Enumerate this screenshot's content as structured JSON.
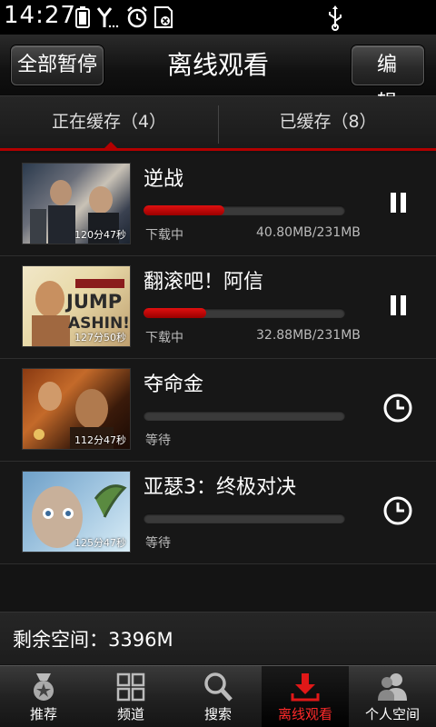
{
  "statusbar": {
    "time": "14:27"
  },
  "titlebar": {
    "left_button": "全部暂停",
    "title": "离线观看",
    "right_button": "编 辑"
  },
  "tabs": [
    {
      "label": "正在缓存（4）",
      "active": true
    },
    {
      "label": "已缓存（8）",
      "active": false
    }
  ],
  "downloads": [
    {
      "title": "逆战",
      "duration": "120分47秒",
      "progress": 0.4,
      "status": "下载中",
      "size": "40.80MB/231MB",
      "action": "pause-icon"
    },
    {
      "title": "翻滚吧！阿信",
      "duration": "127分50秒",
      "progress": 0.31,
      "status": "下载中",
      "size": "32.88MB/231MB",
      "action": "pause-icon"
    },
    {
      "title": "夺命金",
      "duration": "112分47秒",
      "progress": 0.0,
      "status": "等待",
      "size": "",
      "action": "clock-icon"
    },
    {
      "title": "亚瑟3：终极对决",
      "duration": "125分47秒",
      "progress": 0.0,
      "status": "等待",
      "size": "",
      "action": "clock-icon"
    }
  ],
  "storage": {
    "label": "剩余空间：3396M"
  },
  "nav": [
    {
      "label": "推荐",
      "icon": "medal-icon"
    },
    {
      "label": "频道",
      "icon": "grid-icon"
    },
    {
      "label": "搜索",
      "icon": "search-icon"
    },
    {
      "label": "离线观看",
      "icon": "download-icon",
      "active": true
    },
    {
      "label": "个人空间",
      "icon": "people-icon"
    }
  ],
  "colors": {
    "accent": "#b30000",
    "active_text": "#ff2a2a"
  }
}
